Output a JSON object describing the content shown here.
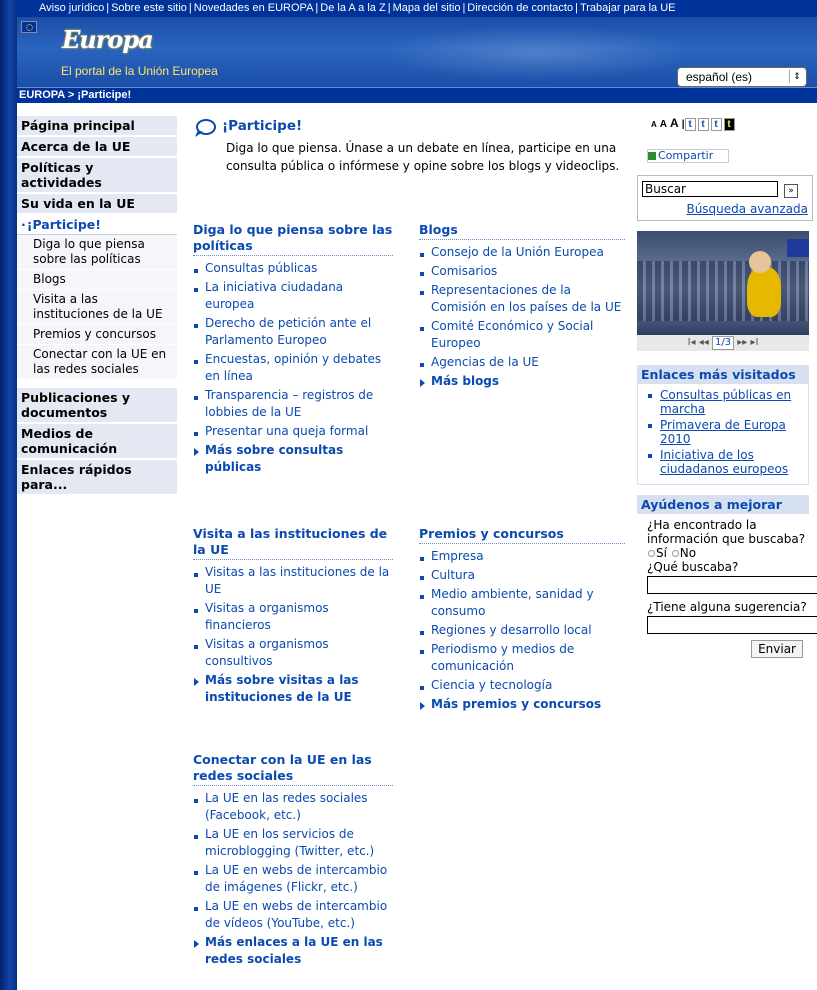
{
  "top_links": [
    "Aviso jurídico",
    "Sobre este sitio",
    "Novedades en EUROPA",
    "De la A a la Z",
    "Mapa del sitio",
    "Dirección de contacto",
    "Trabajar para la UE"
  ],
  "banner": {
    "logo": "Europa",
    "tagline": "El portal de la Unión Europea",
    "language": "español (es)"
  },
  "breadcrumb": "EUROPA > ¡Participe!",
  "nav": {
    "main_top": [
      "Página principal",
      "Acerca de la UE",
      "Políticas y actividades",
      "Su vida en la UE"
    ],
    "active": "¡Participe!",
    "sub": [
      "Diga lo que piensa sobre las políticas",
      "Blogs",
      "Visita a las instituciones de la UE",
      "Premios y concursos",
      "Conectar con la UE en las redes sociales"
    ],
    "main_bottom": [
      "Publicaciones y documentos",
      "Medios de comunicación",
      "Enlaces rápidos para..."
    ]
  },
  "main": {
    "title": "¡Participe!",
    "intro": "Diga lo que piensa. Únase a un debate en línea, participe en una consulta pública o infórmese y opine sobre los blogs y videoclips.",
    "sections": {
      "diga": {
        "heading": "Diga lo que piensa sobre las políticas",
        "items": [
          "Consultas públicas",
          "La iniciativa ciudadana europea",
          "Derecho de petición ante el Parlamento Europeo",
          "Encuestas, opinión y debates en línea",
          "Transparencia – registros de lobbies de la UE",
          "Presentar una queja formal"
        ],
        "more": "Más sobre consultas públicas"
      },
      "blogs": {
        "heading": "Blogs",
        "items": [
          "Consejo de la Unión Europea",
          "Comisarios",
          "Representaciones de la Comisión en los países de la UE",
          "Comité Económico y Social Europeo",
          "Agencias de la UE"
        ],
        "more": "Más blogs"
      },
      "visita": {
        "heading": "Visita a las instituciones de la UE",
        "items": [
          "Visitas a las instituciones de la UE",
          "Visitas a organismos financieros",
          "Visitas a organismos consultivos"
        ],
        "more": "Más sobre visitas a las instituciones de la UE"
      },
      "premios": {
        "heading": "Premios y concursos",
        "items": [
          "Empresa",
          "Cultura",
          "Medio ambiente, sanidad y consumo",
          "Regiones y desarrollo local",
          "Periodismo y medios de comunicación",
          "Ciencia y tecnología"
        ],
        "more": "Más premios y concursos"
      },
      "redes": {
        "heading": "Conectar con la UE en las redes sociales",
        "items": [
          "La UE en las redes sociales (Facebook, etc.)",
          "La UE en los servicios de microblogging (Twitter, etc.)",
          "La UE en webs de intercambio de imágenes (Flickr, etc.)",
          "La UE en webs de intercambio de vídeos (YouTube, etc.)"
        ],
        "more": "Más enlaces a la UE en las redes sociales"
      }
    }
  },
  "right": {
    "font_sizes": [
      "A",
      "A",
      "A"
    ],
    "text_options": [
      "t",
      "t",
      "t",
      "t"
    ],
    "share": "Compartir",
    "search_value": "Buscar",
    "search_go": "»",
    "advanced": "Búsqueda avanzada",
    "pager": {
      "first": "I◂",
      "prev": "◂◂",
      "page": "1/3",
      "next": "▸▸",
      "last": "▸I"
    },
    "most_visited": {
      "heading": "Enlaces más visitados",
      "items": [
        "Consultas públicas en marcha",
        "Primavera de Europa 2010",
        "Iniciativa de los ciudadanos europeos"
      ]
    },
    "feedback": {
      "heading": "Ayúdenos a mejorar",
      "q1": "¿Ha encontrado la información que buscaba?",
      "yes": "Sí",
      "no": "No",
      "q2": "¿Qué buscaba?",
      "q3": "¿Tiene alguna sugerencia?",
      "submit": "Enviar"
    }
  },
  "colors": {
    "eu_blue": "#003399",
    "link_blue": "#0b4ab0",
    "nav_bg": "#e3e8f2"
  }
}
